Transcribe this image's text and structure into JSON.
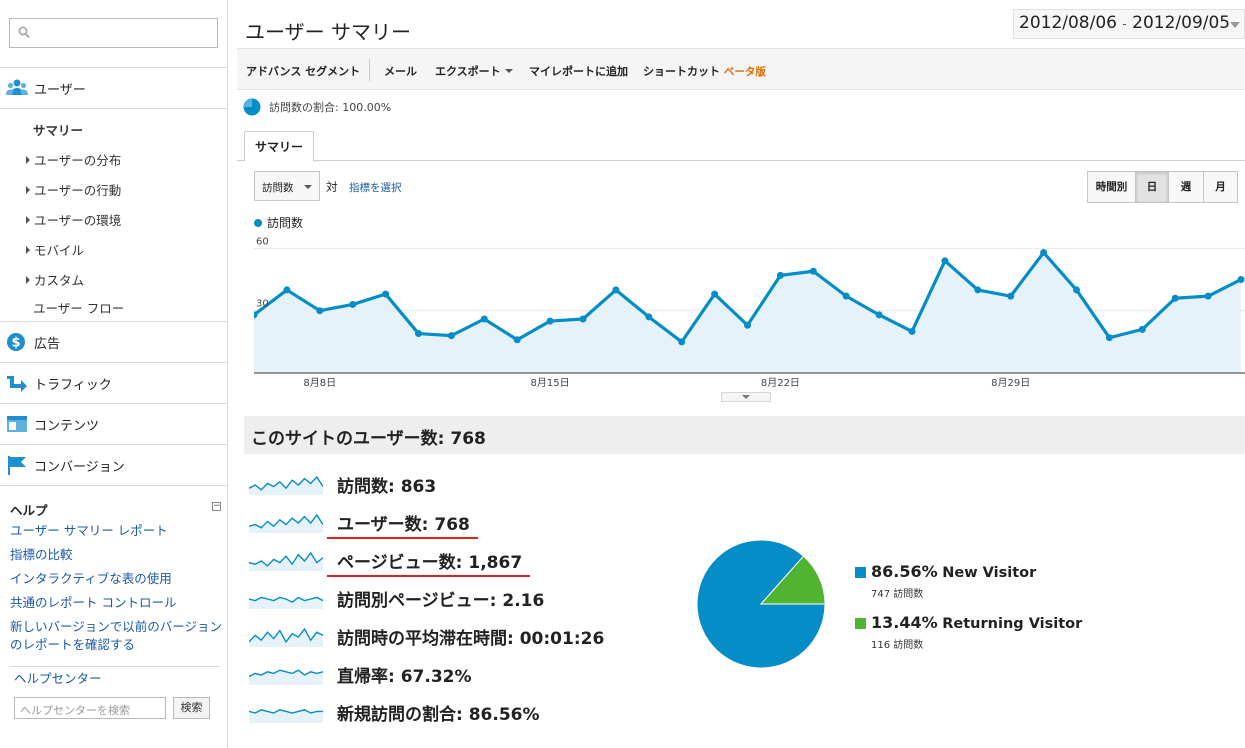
{
  "sidebar": {
    "sections": [
      {
        "label": "ユーザー",
        "icon": "users-icon"
      },
      {
        "label": "広告",
        "icon": "dollar-icon"
      },
      {
        "label": "トラフィック",
        "icon": "traffic-arrow-icon"
      },
      {
        "label": "コンテンツ",
        "icon": "content-icon"
      },
      {
        "label": "コンバージョン",
        "icon": "flag-icon"
      }
    ],
    "user_items": [
      {
        "label": "サマリー",
        "active": true
      },
      {
        "label": "ユーザーの分布",
        "expandable": true
      },
      {
        "label": "ユーザーの行動",
        "expandable": true
      },
      {
        "label": "ユーザーの環境",
        "expandable": true
      },
      {
        "label": "モバイル",
        "expandable": true
      },
      {
        "label": "カスタム",
        "expandable": true
      },
      {
        "label": "ユーザー フロー",
        "expandable": false
      }
    ],
    "help": {
      "title": "ヘルプ",
      "links": [
        "ユーザー サマリー レポート",
        "指標の比較",
        "インタラクティブな表の使用",
        "共通のレポート コントロール",
        "新しいバージョンで以前のバージョンのレポートを確認する"
      ],
      "help_center": "ヘルプセンター",
      "search_placeholder": "ヘルプセンターを検索",
      "search_button": "検索"
    }
  },
  "header": {
    "title": "ユーザー サマリー",
    "date_start": "2012/08/06",
    "date_sep": "-",
    "date_end": "2012/09/05"
  },
  "toolbar": {
    "advanced_segments": "アドバンス セグメント",
    "email": "メール",
    "export": "エクスポート",
    "add_to_dashboard": "マイレポートに追加",
    "shortcut": "ショートカット",
    "beta": "ベータ版"
  },
  "visits_percentage": "訪問数の割合: 100.00%",
  "tabs": [
    "サマリー"
  ],
  "chart_controls": {
    "metric": "訪問数",
    "vs": "対",
    "choose_metric": "指標を選択",
    "periods": [
      "時間別",
      "日",
      "週",
      "月"
    ],
    "active_period": "日"
  },
  "colors": {
    "accent": "#058dc7",
    "returning": "#50b432",
    "area_fill": "#e6f2f9",
    "highlight_underline": "#e0211e"
  },
  "chart_data": [
    {
      "type": "area",
      "series": [
        {
          "name": "訪問数",
          "values": [
            28,
            40,
            30,
            33,
            38,
            19,
            18,
            26,
            16,
            25,
            26,
            40,
            27,
            15,
            38,
            23,
            47,
            49,
            37,
            28,
            20,
            54,
            40,
            37,
            58,
            40,
            17,
            21,
            36,
            37,
            45
          ]
        }
      ],
      "x_tick_labels": [
        "8月8日",
        "8月15日",
        "8月22日",
        "8月29日"
      ],
      "y_tick_labels": [
        "60",
        "30"
      ],
      "ylim": [
        0,
        65
      ],
      "grid": true
    },
    {
      "type": "pie",
      "slices": [
        {
          "label": "New Visitor",
          "pct": "86.56%",
          "value": 86.56,
          "count": "747 訪問数",
          "color": "#058dc7"
        },
        {
          "label": "Returning Visitor",
          "pct": "13.44%",
          "value": 13.44,
          "count": "116 訪問数",
          "color": "#50b432"
        }
      ]
    }
  ],
  "summary": {
    "heading": "このサイトのユーザー数: 768",
    "metrics": [
      {
        "label": "訪問数: 863"
      },
      {
        "label": "ユーザー数: 768",
        "underlined": true
      },
      {
        "label": "ページビュー数: 1,867",
        "underlined": true
      },
      {
        "label": "訪問別ページビュー: 2.16"
      },
      {
        "label": "訪問時の平均滞在時間: 00:01:26"
      },
      {
        "label": "直帰率: 67.32%"
      },
      {
        "label": "新規訪問の割合: 86.56%"
      }
    ]
  }
}
